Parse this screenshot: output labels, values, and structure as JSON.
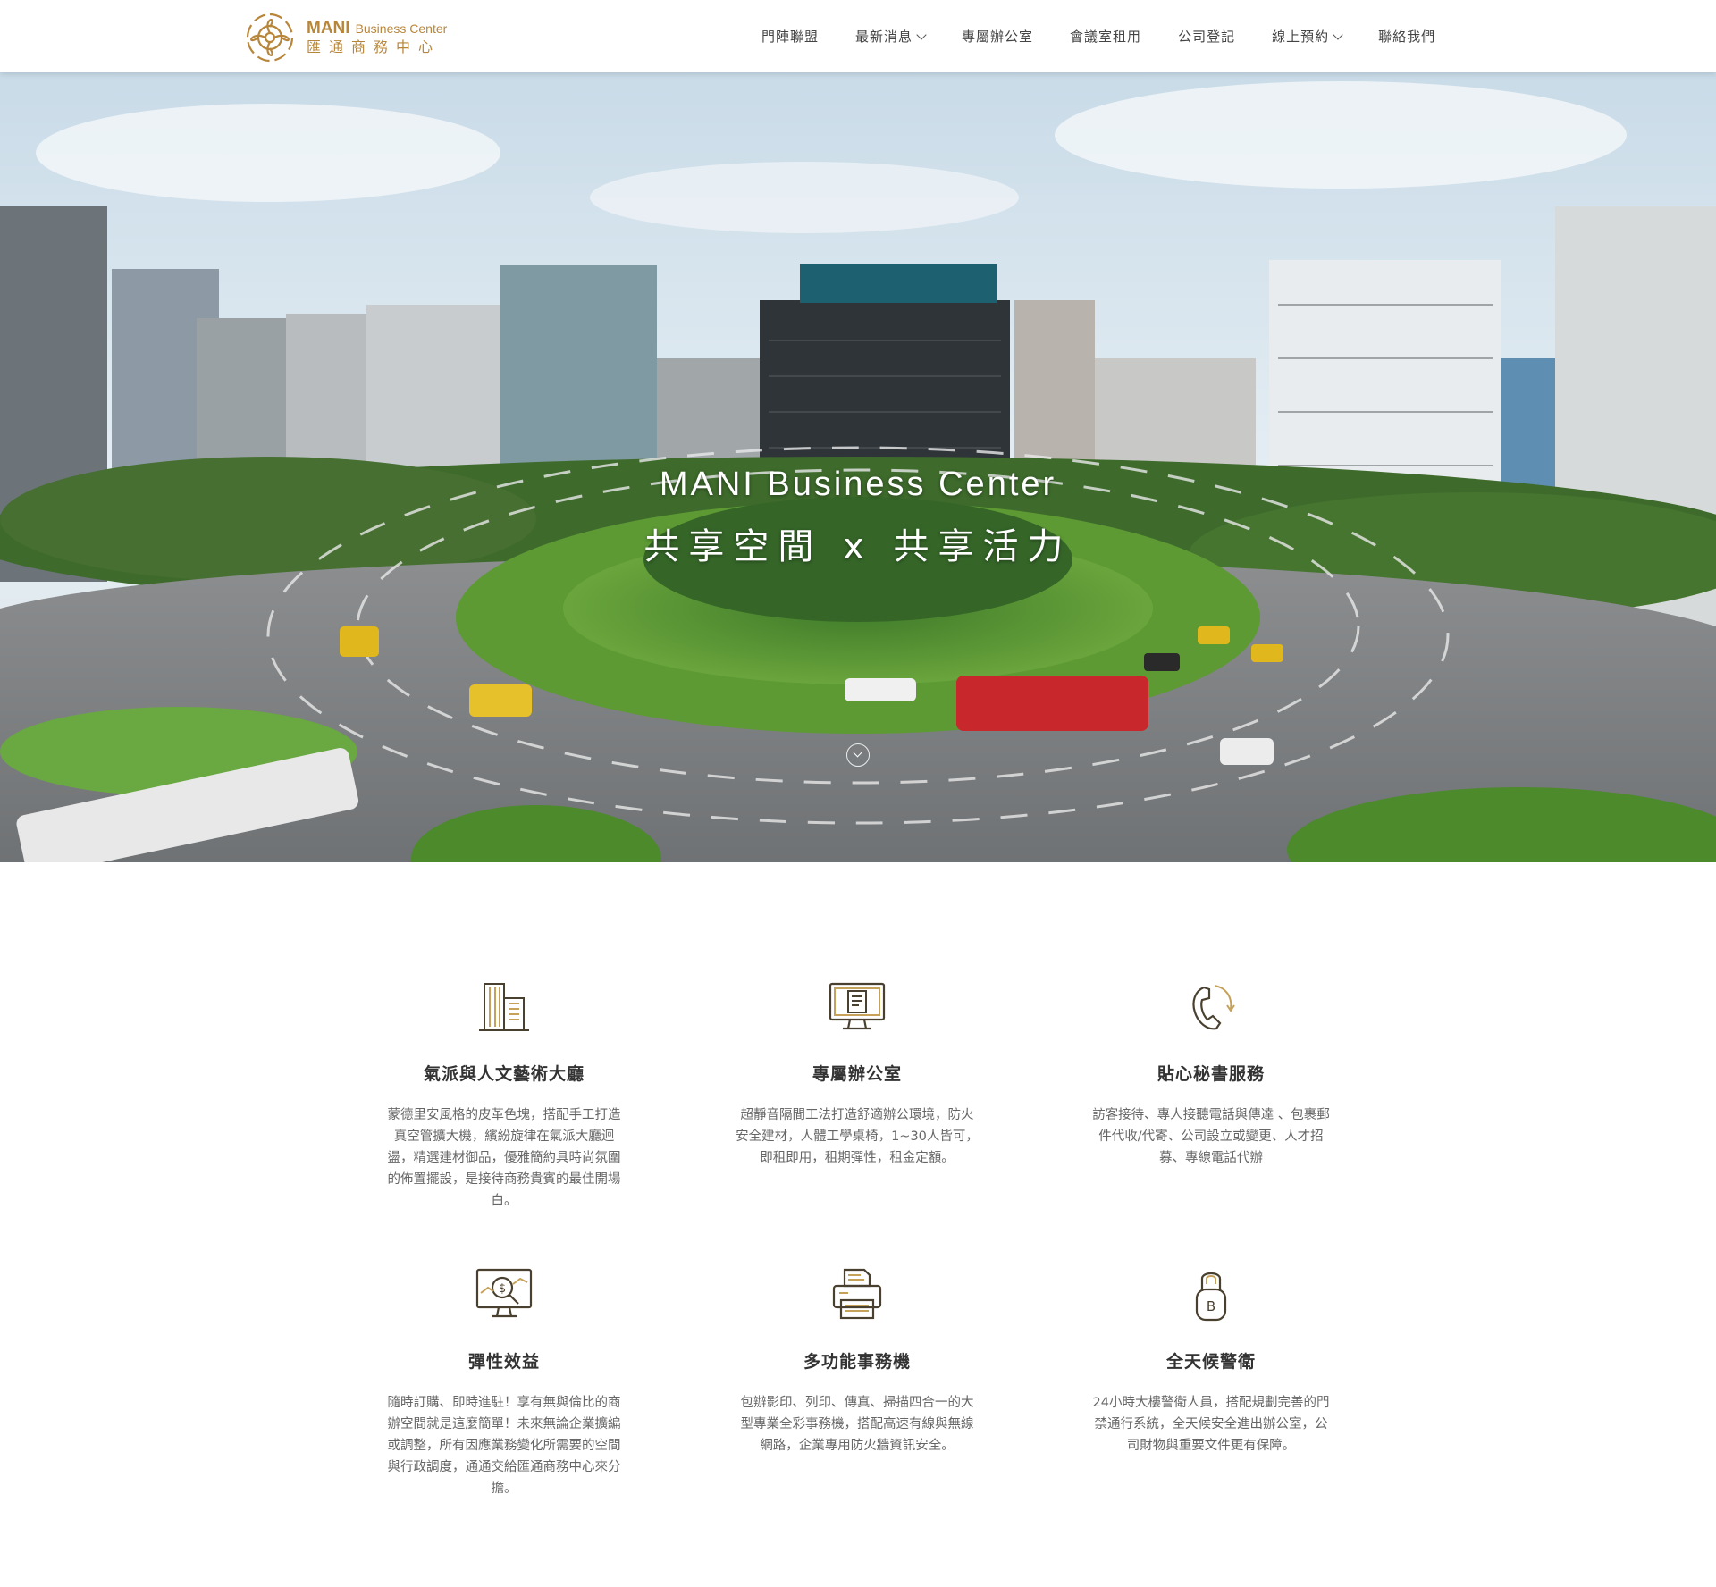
{
  "brand": {
    "name_en": "MANI",
    "name_en_sub": "Business Center",
    "name_zh": "匯通商務中心",
    "color": "#b8863b"
  },
  "nav": [
    {
      "label": "門陣聯盟",
      "dropdown": false
    },
    {
      "label": "最新消息",
      "dropdown": true
    },
    {
      "label": "專屬辦公室",
      "dropdown": false
    },
    {
      "label": "會議室租用",
      "dropdown": false
    },
    {
      "label": "公司登記",
      "dropdown": false
    },
    {
      "label": "線上預約",
      "dropdown": true
    },
    {
      "label": "聯絡我們",
      "dropdown": false
    }
  ],
  "hero": {
    "line1": "MANI  Business Center",
    "line2": "共享空間 x 共享活力",
    "scroll_icon": "chevron-down-circle-icon"
  },
  "features": [
    {
      "icon": "building-icon",
      "title": "氣派與人文藝術大廳",
      "desc": "蒙德里安風格的皮革色塊，搭配手工打造真空管擴大機，繽紛旋律在氣派大廳迴盪，精選建材御品，優雅簡約具時尚氛圍的佈置擺設，是接待商務貴賓的最佳開場白。"
    },
    {
      "icon": "monitor-document-icon",
      "title": "專屬辦公室",
      "desc": "超靜音隔間工法打造舒適辦公環境，防火安全建材，人體工學桌椅，1~30人皆可，即租即用，租期彈性，租金定額。"
    },
    {
      "icon": "phone-service-icon",
      "title": "貼心秘書服務",
      "desc": "訪客接待、專人接聽電話與傳達 、包裹郵件代收/代寄、公司設立或變更、人才招募、專線電話代辦"
    },
    {
      "icon": "monitor-dollar-icon",
      "title": "彈性效益",
      "desc": "隨時訂購、即時進駐！享有無與倫比的商辦空間就是這麼簡單！未來無論企業擴編或調整，所有因應業務變化所需要的空間與行政調度，通通交給匯通商務中心來分擔。"
    },
    {
      "icon": "printer-icon",
      "title": "多功能事務機",
      "desc": "包辦影印、列印、傳真、掃描四合一的大型專業全彩事務機，搭配高速有線與無線網路，企業專用防火牆資訊安全。"
    },
    {
      "icon": "padlock-icon",
      "title": "全天候警衛",
      "desc": "24小時大樓警衛人員，搭配規劃完善的門禁通行系統，全天候安全進出辦公室，公司財物與重要文件更有保障。"
    }
  ]
}
